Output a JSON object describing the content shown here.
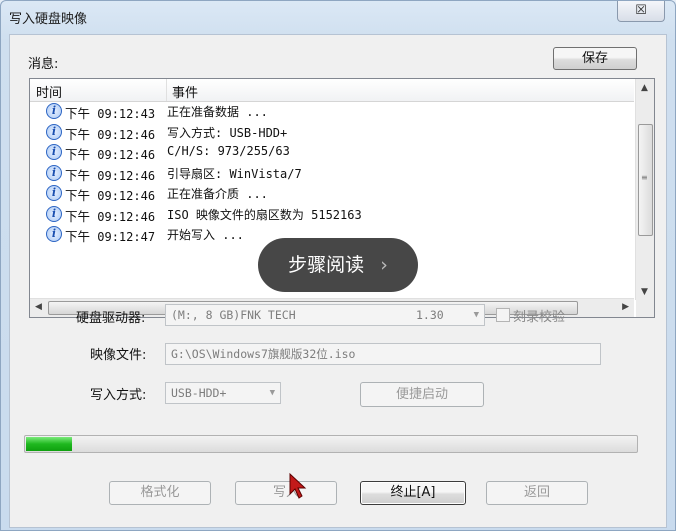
{
  "window": {
    "title": "写入硬盘映像",
    "close_label": "☒"
  },
  "messages": {
    "label": "消息:",
    "save_button": "保存",
    "columns": {
      "time": "时间",
      "event": "事件"
    },
    "rows": [
      {
        "ampm": "下午",
        "time": "09:12:43",
        "event": "正在准备数据 ..."
      },
      {
        "ampm": "下午",
        "time": "09:12:46",
        "event": "写入方式: USB-HDD+"
      },
      {
        "ampm": "下午",
        "time": "09:12:46",
        "event": "C/H/S: 973/255/63"
      },
      {
        "ampm": "下午",
        "time": "09:12:46",
        "event": "引导扇区: WinVista/7"
      },
      {
        "ampm": "下午",
        "time": "09:12:46",
        "event": "正在准备介质 ..."
      },
      {
        "ampm": "下午",
        "time": "09:12:46",
        "event": "ISO 映像文件的扇区数为 5152163"
      },
      {
        "ampm": "下午",
        "time": "09:12:47",
        "event": "开始写入 ..."
      }
    ]
  },
  "overlay": {
    "text": "步骤阅读",
    "chevron": "›"
  },
  "form": {
    "drive_label": "硬盘驱动器:",
    "drive_value": "(M:, 8 GB)FNK TECH",
    "drive_version": "1.30",
    "verify_label": "刻录校验",
    "image_label": "映像文件:",
    "image_value": "G:\\OS\\Windows7旗舰版32位.iso",
    "mode_label": "写入方式:",
    "mode_value": "USB-HDD+",
    "quick_boot_button": "便捷启动"
  },
  "progress": {
    "fraction": 0.075,
    "color": "#1fb81f"
  },
  "buttons": {
    "format": "格式化",
    "write": "写入",
    "stop": "终止[A]",
    "back": "返回"
  }
}
